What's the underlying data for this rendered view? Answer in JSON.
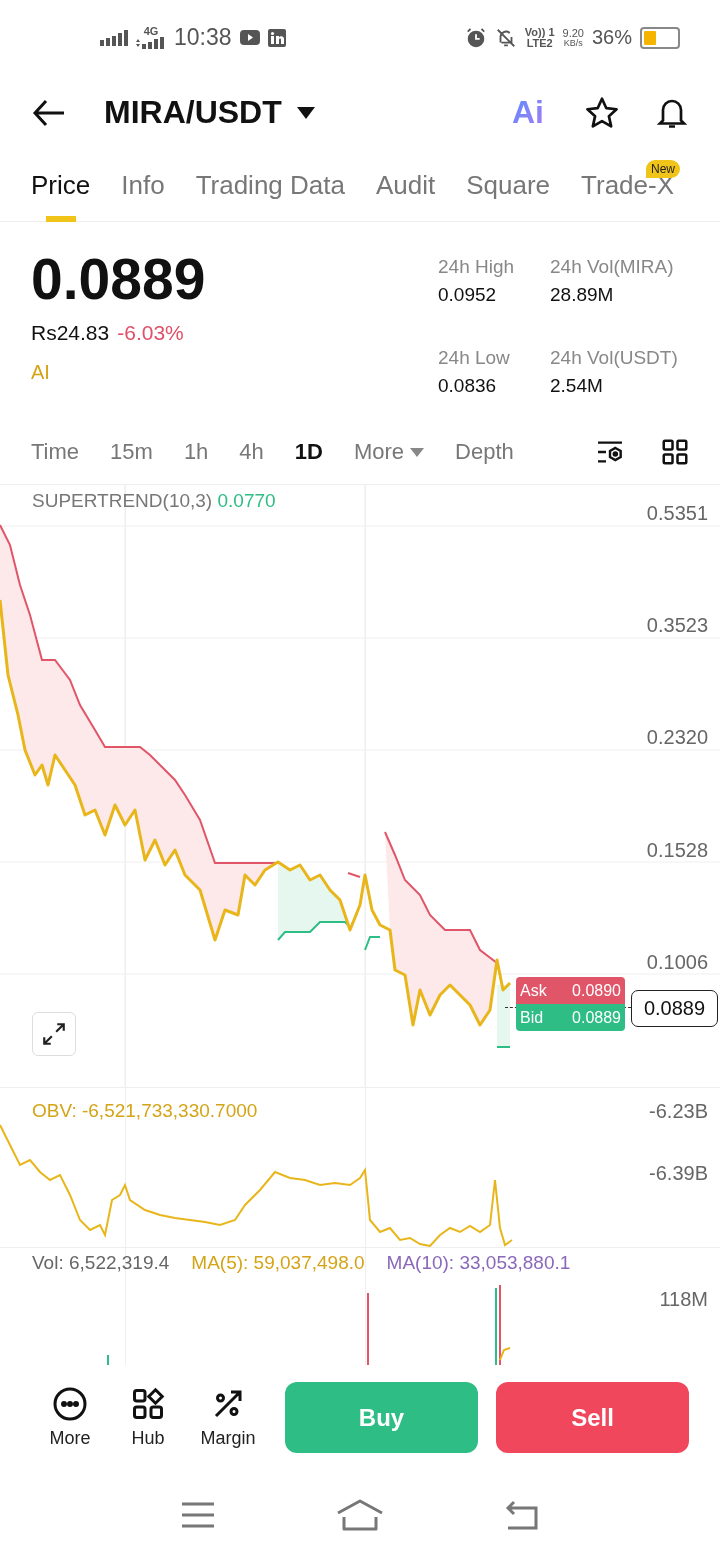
{
  "status_bar": {
    "network": "4G",
    "time": "10:38",
    "volte_top": "Vo)) 1",
    "volte_bottom": "LTE2",
    "speed_value": "9.20",
    "speed_unit": "KB/s",
    "battery": "36%"
  },
  "header": {
    "pair": "MIRA/USDT",
    "ai_logo": "Ai"
  },
  "tabs": [
    {
      "label": "Price",
      "selected": true
    },
    {
      "label": "Info",
      "selected": false
    },
    {
      "label": "Trading Data",
      "selected": false
    },
    {
      "label": "Audit",
      "selected": false
    },
    {
      "label": "Square",
      "selected": false
    },
    {
      "label": "Trade-X",
      "selected": false,
      "badge": "New"
    }
  ],
  "price": {
    "last": "0.0889",
    "fiat": "Rs24.83",
    "change": "-6.03%",
    "ai_label": "AI"
  },
  "stats": [
    {
      "label": "24h High",
      "value": "0.0952"
    },
    {
      "label": "24h Vol(MIRA)",
      "value": "28.89M"
    },
    {
      "label": "24h Low",
      "value": "0.0836"
    },
    {
      "label": "24h Vol(USDT)",
      "value": "2.54M"
    }
  ],
  "timeframes": [
    {
      "label": "Time",
      "selected": false,
      "kind": "option"
    },
    {
      "label": "15m",
      "selected": false,
      "kind": "option"
    },
    {
      "label": "1h",
      "selected": false,
      "kind": "option"
    },
    {
      "label": "4h",
      "selected": false,
      "kind": "option"
    },
    {
      "label": "1D",
      "selected": true,
      "kind": "option"
    },
    {
      "label": "More",
      "selected": false,
      "kind": "dropdown"
    },
    {
      "label": "Depth",
      "selected": false,
      "kind": "option"
    }
  ],
  "main_chart": {
    "indicator": "SUPERTREND(10,3)",
    "indicator_value": "0.0770",
    "axis_labels": [
      "0.5351",
      "0.3523",
      "0.2320",
      "0.1528",
      "0.1006"
    ],
    "ask": {
      "label": "Ask",
      "value": "0.0890"
    },
    "bid": {
      "label": "Bid",
      "value": "0.0889"
    },
    "last_price_tag": "0.0889"
  },
  "obv_chart": {
    "label": "OBV: -6,521,733,330.7000",
    "axis_labels": [
      "-6.23B",
      "-6.39B"
    ]
  },
  "volume_chart": {
    "vol": "Vol: 6,522,319.4",
    "ma5": "MA(5): 59,037,498.0",
    "ma10": "MA(10): 33,053,880.1",
    "axis_labels": [
      "118M"
    ]
  },
  "actions": [
    {
      "label": "More"
    },
    {
      "label": "Hub"
    },
    {
      "label": "Margin"
    }
  ],
  "trade_buttons": [
    {
      "label": "Buy",
      "kind": "buy"
    },
    {
      "label": "Sell",
      "kind": "sell"
    }
  ]
}
